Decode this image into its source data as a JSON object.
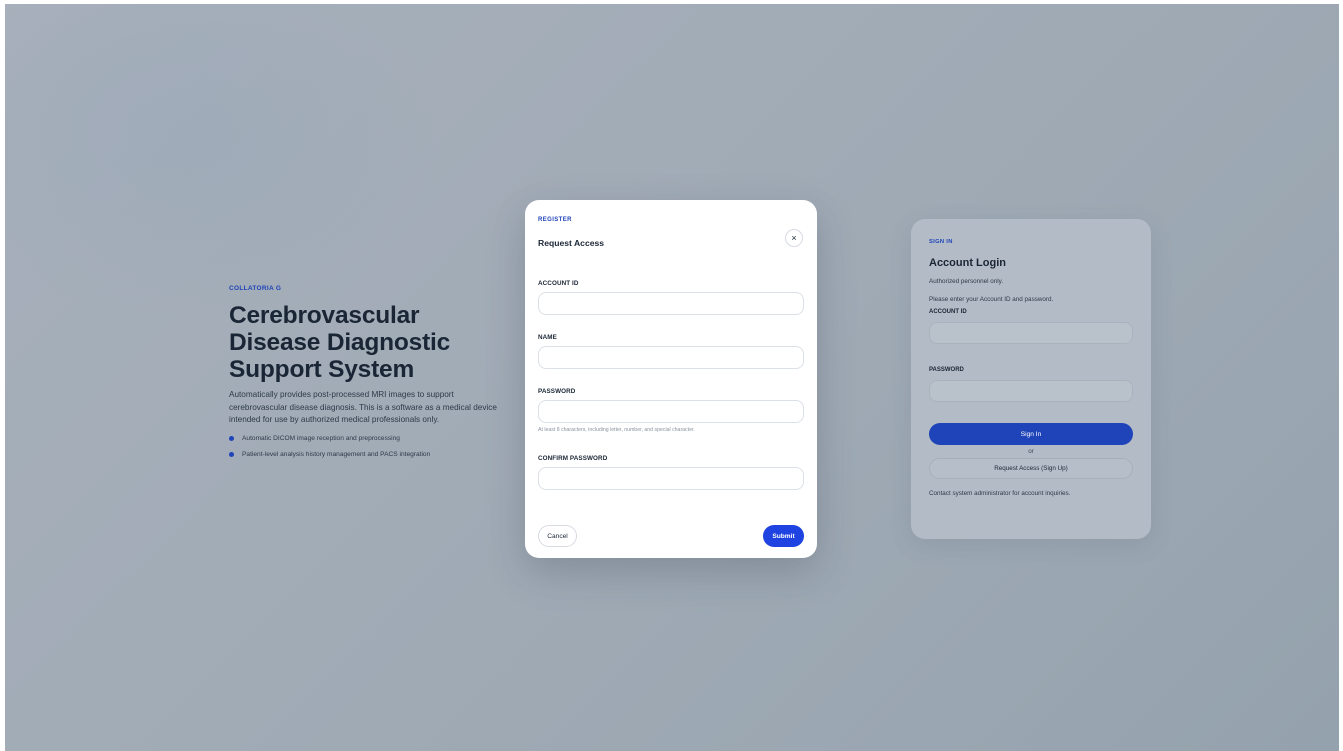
{
  "hero": {
    "kicker": "COLLATORIA G",
    "title": "Cerebrovascular Disease Diagnostic Support System",
    "description": "Automatically provides post-processed MRI images to support cerebrovascular disease diagnosis. This is a software as a medical device intended for use by authorized medical professionals only.",
    "bullets": [
      "Automatic DICOM image reception and preprocessing",
      "Patient-level analysis history management and PACS integration"
    ]
  },
  "login": {
    "kicker": "SIGN IN",
    "title": "Account Login",
    "note1": "Authorized personnel only.",
    "note2": "Please enter your Account ID and password.",
    "account_label": "ACCOUNT ID",
    "password_label": "PASSWORD",
    "signin_label": "Sign In",
    "or_label": "or",
    "signup_label": "Request Access (Sign Up)",
    "footer": "Contact system administrator for account inquiries."
  },
  "register": {
    "kicker": "REGISTER",
    "title": "Request Access",
    "close_glyph": "×",
    "fields": {
      "account_id": {
        "label": "ACCOUNT ID",
        "value": ""
      },
      "name": {
        "label": "NAME",
        "value": ""
      },
      "password": {
        "label": "PASSWORD",
        "value": "",
        "help": "At least 8 characters, including letter, number, and special character."
      },
      "confirm_password": {
        "label": "CONFIRM PASSWORD",
        "value": ""
      }
    },
    "cancel_label": "Cancel",
    "submit_label": "Submit"
  },
  "colors": {
    "accent": "#1f43b8",
    "submit": "#1f43e0",
    "overlay": "#a1abb6"
  }
}
